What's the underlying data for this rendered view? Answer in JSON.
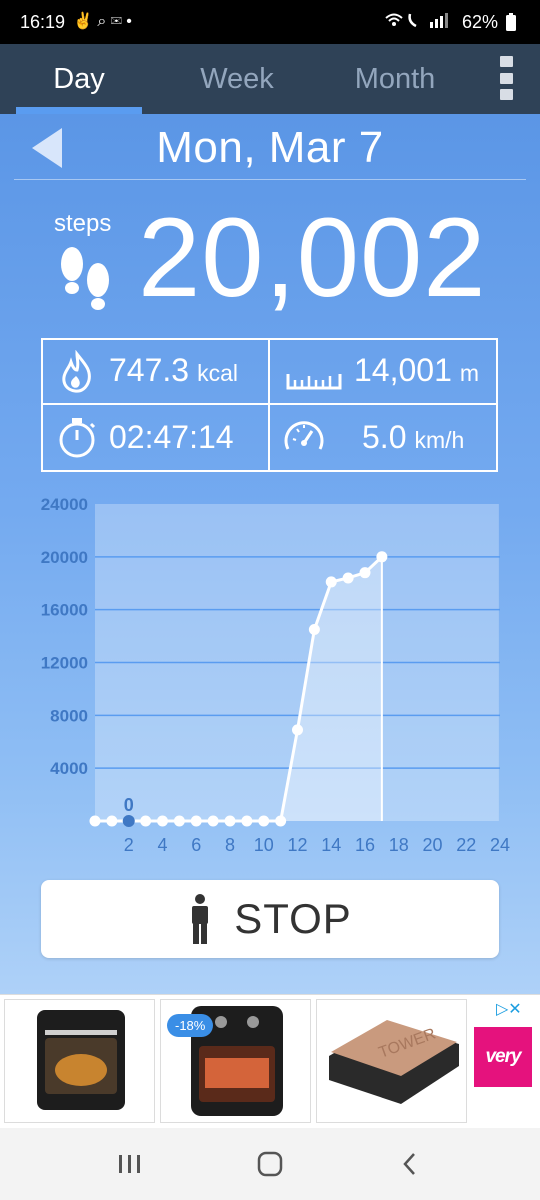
{
  "status_bar": {
    "time": "16:19",
    "battery": "62%"
  },
  "tabs": [
    {
      "label": "Day",
      "active": true
    },
    {
      "label": "Week",
      "active": false
    },
    {
      "label": "Month",
      "active": false
    }
  ],
  "header": {
    "date": "Mon, Mar 7"
  },
  "steps": {
    "label": "steps",
    "value": "20,002"
  },
  "stats": {
    "calories": {
      "value": "747.3",
      "unit": "kcal"
    },
    "distance": {
      "value": "14,001",
      "unit": "m"
    },
    "duration": {
      "value": "02:47:14"
    },
    "speed": {
      "value": "5.0",
      "unit": "km/h"
    }
  },
  "stop_button": {
    "label": "STOP"
  },
  "ad": {
    "discount_badge": "-18%",
    "brand_logo": "very"
  },
  "colors": {
    "tab_bar": "#2f4257",
    "tab_indicator": "#5a9cf0",
    "gradient_top": "#5b96e6",
    "gradient_bottom": "#aed1f8",
    "ad_brand": "#e5127d"
  },
  "chart_data": {
    "type": "line",
    "x": [
      0,
      1,
      2,
      3,
      4,
      5,
      6,
      7,
      8,
      9,
      10,
      11,
      12,
      13,
      14,
      15,
      16,
      17
    ],
    "y": [
      0,
      0,
      0,
      0,
      0,
      0,
      0,
      0,
      0,
      0,
      0,
      0,
      6900,
      14500,
      18100,
      18400,
      18800,
      20002
    ],
    "x_ticks": [
      2,
      4,
      6,
      8,
      10,
      12,
      14,
      16,
      18,
      20,
      22,
      24
    ],
    "y_ticks": [
      4000,
      8000,
      12000,
      16000,
      20000,
      24000
    ],
    "xlim": [
      0,
      24
    ],
    "ylim": [
      0,
      24000
    ],
    "selected_point": {
      "x": 2,
      "label": "0"
    },
    "grid": true,
    "title": "",
    "xlabel": "",
    "ylabel": ""
  }
}
